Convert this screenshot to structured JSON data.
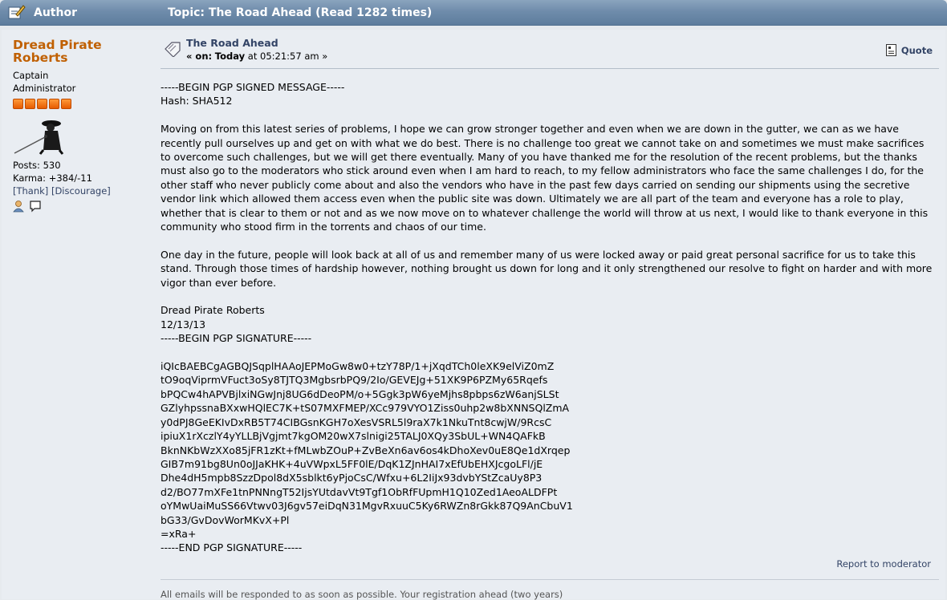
{
  "header": {
    "author_label": "Author",
    "topic_label": "Topic: The Road Ahead  (Read 1282 times)"
  },
  "poster": {
    "name": "Dread Pirate Roberts",
    "title": "Captain",
    "group": "Administrator",
    "posts": "Posts: 530",
    "karma": "Karma: +384/-11",
    "thank": "[Thank]",
    "discourage": "[Discourage]",
    "stars": 5
  },
  "post": {
    "subject": "The Road Ahead",
    "date_on": "« on:",
    "date_day": "Today",
    "date_rest": "at 05:21:57 am »",
    "quote_label": "Quote",
    "body": {
      "pgp_header": "-----BEGIN PGP SIGNED MESSAGE-----\nHash: SHA512",
      "para1": "Moving on from this latest series of problems, I hope we can grow stronger together and even when we are down in the gutter, we can as we have recently pull ourselves up and get on with what we do best. There is no challenge too great we cannot take on and sometimes we must make sacrifices to overcome such challenges, but we will get there eventually. Many of you have thanked me for the resolution of the recent problems, but the thanks must also go to the moderators who stick around even when I am hard to reach, to my fellow administrators who face the same challenges I do, for the other staff who never publicly come about and also the vendors who have in the past few days carried on sending our shipments using the secretive vendor link which allowed them access even when the public site was down. Ultimately we are all part of the team and everyone has a role to play, whether that is clear to them or not and as we now move on to whatever challenge the world will throw at us next, I would like to thank everyone in this community who stood firm in the torrents and chaos of our time.",
      "para2": "One day in the future, people will look back at all of us and remember many of us were locked away or paid great personal sacrifice for us to take this stand. Through those times of hardship however, nothing brought us down for long and it only strengthened our resolve to fight on harder and with more vigor than ever before.",
      "signoff": "Dread Pirate Roberts\n12/13/13\n-----BEGIN PGP SIGNATURE-----",
      "signature": "iQIcBAEBCgAGBQJSqplHAAoJEPMoGw8w0+tzY78P/1+jXqdTCh0leXK9elViZ0mZ\ntO9oqViprmVFuct3oSy8TJTQ3MgbsrbPQ9/2Io/GEVEJg+51XK9P6PZMy65Rqefs\nbPQCw4hAPVBjlxiNGwJnj8UG6dDeoPM/o+5Ggk3pW6yeMjhs8pbps6zW6anjSLSt\nGZlyhpssnaBXxwHQlEC7K+tS07MXFMEP/XCc979VYO1Ziss0uhp2w8bXNNSQlZmA\ny0dPJ8GeEKIvDxRB5T74CIBGsnKGH7oXesVSRL5l9raX7k1NkuTnt8cwjW/9RcsC\nipiuX1rXczlY4yYLLBjVgjmt7kgOM20wX7slnigi25TALJ0XQy3SbUL+WN4QAFkB\nBknNKbWzXXo85jFR1zKt+fMLwbZOuP+ZvBeXn6av6os4kDhoXev0uE8Qe1dXrqep\nGIB7m91bg8Un0oJJaKHK+4uVWpxL5FF0lE/DqK1ZJnHAI7xEfUbEHXJcgoLFl/jE\nDhe4dH5mpb8SzzDpol8dX5sblkt6yPjoCsC/Wfxu+6L2IiJx93dvbYStZcaUy8P3\nd2/BO77mXFe1tnPNNngT52IjsYUtdavVt9Tgf1ObRfFUpmH1Q10Zed1AeoALDFPt\noYMwUaiMuSS66Vtwv03J6gv57eiDqN31MgvRxuuC5Ky6RWZn8rGkk87Q9AnCbuV1\nbG33/GvDovWorMKvX+Pl\n=xRa+\n-----END PGP SIGNATURE-----"
    },
    "report_label": "Report to moderator",
    "signature_line": "All emails will be responded to as soon as possible. Your registration ahead (two years)"
  }
}
